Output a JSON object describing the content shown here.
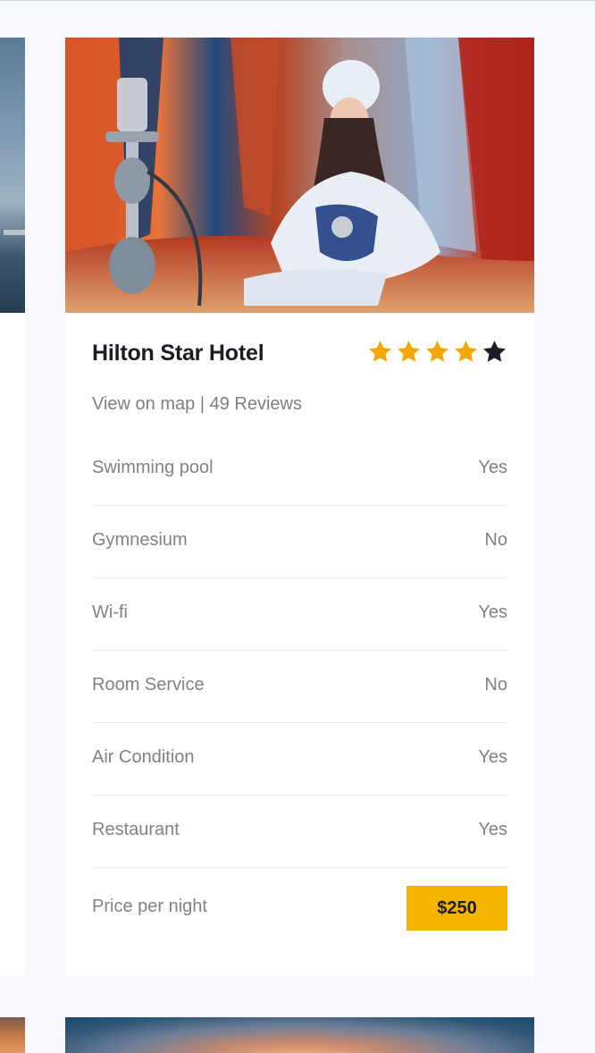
{
  "hotel": {
    "name": "Hilton Star Hotel",
    "rating": 4,
    "max_rating": 5,
    "map_link": "View on map",
    "separator": "|",
    "reviews": "49 Reviews"
  },
  "features": [
    {
      "label": "Swimming pool",
      "value": "Yes"
    },
    {
      "label": "Gymnesium",
      "value": "No"
    },
    {
      "label": "Wi-fi",
      "value": "Yes"
    },
    {
      "label": "Room Service",
      "value": "No"
    },
    {
      "label": "Air Condition",
      "value": "Yes"
    },
    {
      "label": "Restaurant",
      "value": "Yes"
    }
  ],
  "price": {
    "label": "Price per night",
    "value": "$250"
  },
  "colors": {
    "accent": "#f6b400",
    "star_filled": "#f6a800",
    "star_empty": "#1b1d24",
    "text_dark": "#1b1d24",
    "text_muted": "#808189"
  },
  "icons": {
    "star": "star-icon"
  }
}
